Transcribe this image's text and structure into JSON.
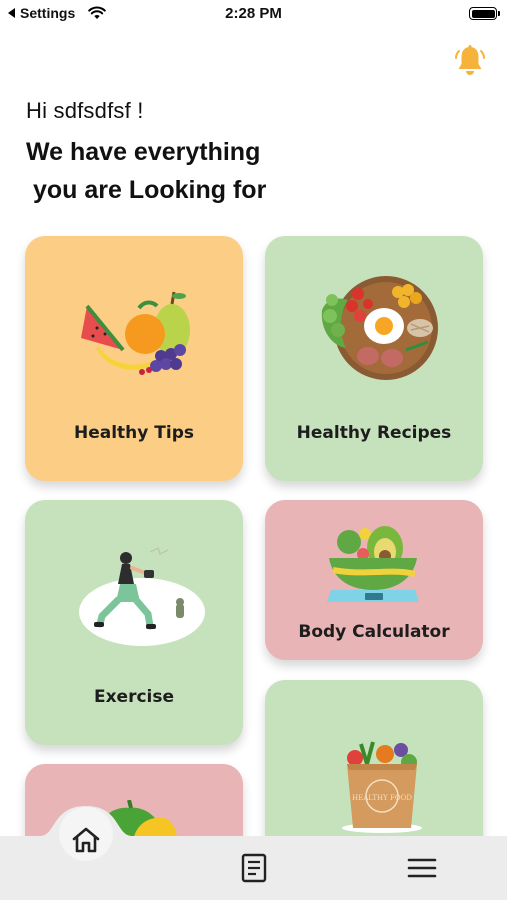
{
  "status_bar": {
    "back_label": "Settings",
    "time": "2:28 PM"
  },
  "header": {
    "greeting": "Hi sdfsdfsf !",
    "headline": "We have everything\n you are Looking for"
  },
  "cards": [
    {
      "label": "Healthy Tips",
      "color": "#fbcd85",
      "icon": "fruits-icon"
    },
    {
      "label": "Healthy Recipes",
      "color": "#c6e2bd",
      "icon": "meal-plate-icon"
    },
    {
      "label": "Exercise",
      "color": "#c6e2bd",
      "icon": "workout-woman-icon"
    },
    {
      "label": "Body Calculator",
      "color": "#e8b4b6",
      "icon": "scale-food-icon"
    },
    {
      "label": "",
      "color": "#e8b4b6",
      "icon": "bell-pepper-icon"
    },
    {
      "label": "",
      "color": "#c6e2bd",
      "icon": "healthy-food-bag-icon"
    }
  ],
  "bag_text": "HEALTHY FOOD",
  "colors": {
    "accent_bell": "#f6b33c",
    "nav_background": "#ececec"
  },
  "bottom_nav": {
    "items": [
      "home-icon",
      "document-icon",
      "menu-icon"
    ],
    "active": "home-icon"
  }
}
